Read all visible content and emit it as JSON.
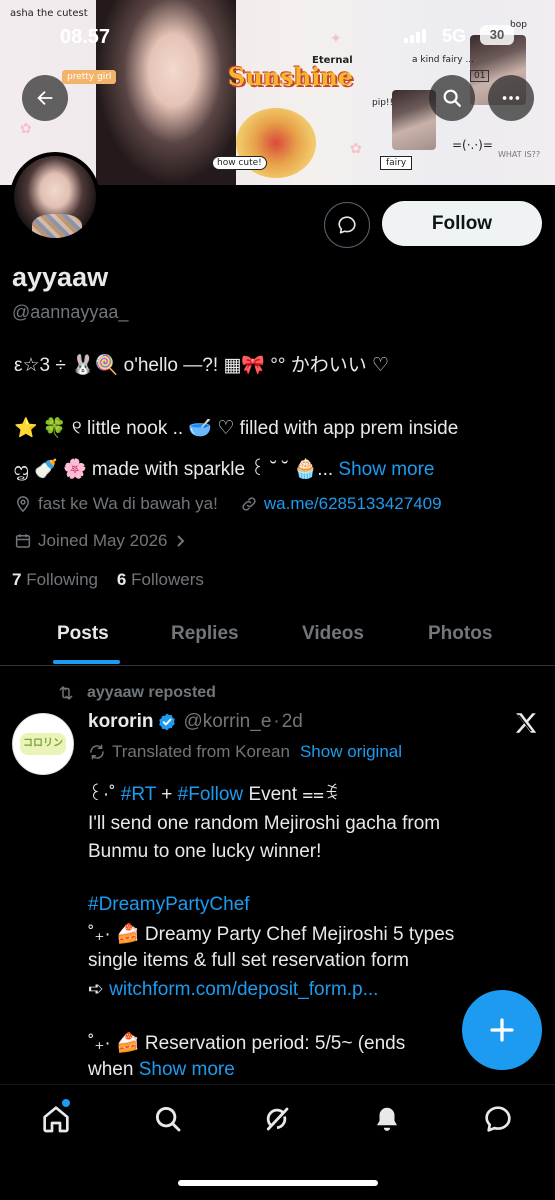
{
  "status_bar": {
    "time": "08.57",
    "network": "5G",
    "battery": "30"
  },
  "banner": {
    "stickers": {
      "asha": "asha the cutest",
      "pretty": "pretty girl",
      "eternal": "Eternal",
      "sunshine": "Sunshine",
      "kind": "a  kind  fairy ...",
      "number": "01",
      "bop": "bop",
      "pip": "pip!!",
      "howcute": "how cute!",
      "fairy": "fairy",
      "face": "=(·.·)=",
      "what": "WHAT IS??"
    }
  },
  "header": {
    "back_icon": "arrow-left-icon",
    "search_icon": "search-icon",
    "more_icon": "more-icon"
  },
  "profile": {
    "display_name": "ayyaaw",
    "handle": "@aannayyaa_",
    "follow_label": "Follow",
    "bio_line1": "ε☆3 ÷ 🐰🍭 o'hello —?! ▦🎀 °° かわいい ♡",
    "bio_line2": "⭐ 🍀 ୧ little nook .. 🥣 ♡ filled with app prem inside",
    "bio_line3": "ᦗ 🍼 🌸 made with sparkle ꒰ ˘ ˘ 🧁...",
    "show_more": "Show more",
    "location": "fast ke Wa di bawah ya!",
    "link": "wa.me/6285133427409",
    "joined": "Joined May 2026",
    "following_count": "7",
    "following_label": "Following",
    "followers_count": "6",
    "followers_label": "Followers"
  },
  "tabs": [
    "Posts",
    "Replies",
    "Videos",
    "Photos"
  ],
  "tweet": {
    "reposted_by": "ayyaaw reposted",
    "avatar_text": "コロリン",
    "author_name": "kororin",
    "author_handle": "@korrin_e",
    "time": "2d",
    "translated": "Translated from Korean",
    "show_original": "Show original",
    "line1_prefix": "꒰·˚",
    "line1_tag1": "#RT",
    "line1_plus": "+",
    "line1_tag2": "#Follow",
    "line1_suffix": "Event ⩵ꉂ",
    "line2": "I'll send one random Mejiroshi gacha from",
    "line3": "Bunmu to one lucky winner!",
    "hashtag": "#DreamyPartyChef",
    "line5": "˚₊· 🍰 Dreamy Party Chef Mejiroshi 5 types",
    "line6": "single items & full set reservation form",
    "line7_prefix": "➪",
    "line7_link": "witchform.com/deposit_form.p...",
    "line8": "˚₊· 🍰 Reservation period: 5/5~ (ends",
    "line9_prefix": "when",
    "show_more": "Show more"
  },
  "fab": {
    "icon": "plus-icon"
  },
  "bottom_nav": [
    "home-icon",
    "search-icon",
    "grok-icon",
    "notifications-icon",
    "messages-icon"
  ]
}
